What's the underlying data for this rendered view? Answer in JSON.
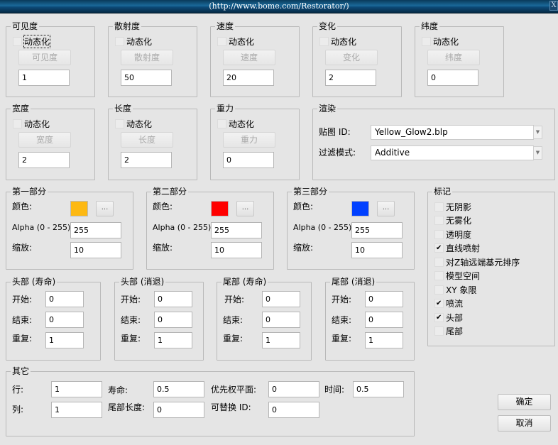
{
  "window": {
    "title": "(http://www.bome.com/Restorator/)",
    "close_label": "X"
  },
  "dynamic_label": "动态化",
  "top_groups": [
    {
      "title": "可见度",
      "button": "可见度",
      "value": "1",
      "dynamic": false
    },
    {
      "title": "散射度",
      "button": "散射度",
      "value": "50",
      "dynamic": false
    },
    {
      "title": "速度",
      "button": "速度",
      "value": "20",
      "dynamic": false
    },
    {
      "title": "变化",
      "button": "变化",
      "value": "2",
      "dynamic": false
    },
    {
      "title": "纬度",
      "button": "纬度",
      "value": "0",
      "dynamic": false
    },
    {
      "title": "宽度",
      "button": "宽度",
      "value": "2",
      "dynamic": false
    },
    {
      "title": "长度",
      "button": "长度",
      "value": "2",
      "dynamic": false
    },
    {
      "title": "重力",
      "button": "重力",
      "value": "0",
      "dynamic": false
    }
  ],
  "render": {
    "title": "渲染",
    "texture_label": "贴图 ID:",
    "texture_value": "Yellow_Glow2.blp",
    "filter_label": "过滤模式:",
    "filter_value": "Additive"
  },
  "segments": [
    {
      "title": "第一部分",
      "color_label": "颜色:",
      "color": "#fdb913",
      "alpha_label": "Alpha (0 - 255):",
      "alpha": "255",
      "scale_label": "缩放:",
      "scale": "10",
      "picker_label": "..."
    },
    {
      "title": "第二部分",
      "color_label": "颜色:",
      "color": "#ff0000",
      "alpha_label": "Alpha (0 - 255):",
      "alpha": "255",
      "scale_label": "缩放:",
      "scale": "10",
      "picker_label": "..."
    },
    {
      "title": "第三部分",
      "color_label": "颜色:",
      "color": "#0040ff",
      "alpha_label": "Alpha (0 - 255):",
      "alpha": "255",
      "scale_label": "缩放:",
      "scale": "10",
      "picker_label": "..."
    }
  ],
  "flags": {
    "title": "标记",
    "items": [
      {
        "label": "无阴影",
        "checked": false
      },
      {
        "label": "无雾化",
        "checked": false
      },
      {
        "label": "透明度",
        "checked": false
      },
      {
        "label": "直线喷射",
        "checked": true
      },
      {
        "label": "对Z轴远端基元排序",
        "checked": false
      },
      {
        "label": "模型空间",
        "checked": false
      },
      {
        "label": "XY 象限",
        "checked": false
      },
      {
        "label": "喷流",
        "checked": true
      },
      {
        "label": "头部",
        "checked": true
      },
      {
        "label": "尾部",
        "checked": false
      }
    ]
  },
  "uv_groups": [
    {
      "title": "头部 (寿命)",
      "start_label": "开始:",
      "start": "0",
      "end_label": "结束:",
      "end": "0",
      "repeat_label": "重复:",
      "repeat": "1"
    },
    {
      "title": "头部 (消退)",
      "start_label": "开始:",
      "start": "0",
      "end_label": "结束:",
      "end": "0",
      "repeat_label": "重复:",
      "repeat": "1"
    },
    {
      "title": "尾部 (寿命)",
      "start_label": "开始:",
      "start": "0",
      "end_label": "结束:",
      "end": "0",
      "repeat_label": "重复:",
      "repeat": "1"
    },
    {
      "title": "尾部 (消退)",
      "start_label": "开始:",
      "start": "0",
      "end_label": "结束:",
      "end": "0",
      "repeat_label": "重复:",
      "repeat": "1"
    }
  ],
  "other": {
    "title": "其它",
    "rows_label": "行:",
    "rows": "1",
    "cols_label": "列:",
    "cols": "1",
    "life_label": "寿命:",
    "life": "0.5",
    "tail_length_label": "尾部长度:",
    "tail_length": "0",
    "priority_label": "优先权平面:",
    "priority": "0",
    "replaceable_label": "可替换 ID:",
    "replaceable": "0",
    "time_label": "时间:",
    "time": "0.5"
  },
  "buttons": {
    "ok": "确定",
    "cancel": "取消"
  }
}
